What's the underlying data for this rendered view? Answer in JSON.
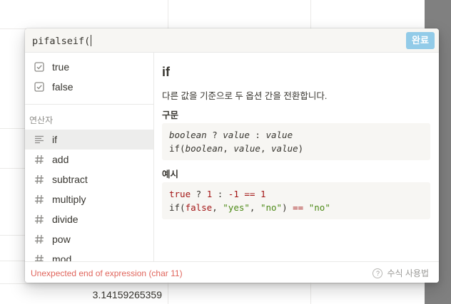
{
  "background": {
    "cell_value": "3.14159265359"
  },
  "formula": {
    "input_value": "pifalseif(",
    "done_label": "완료"
  },
  "sidebar": {
    "top_items": [
      {
        "label": "true",
        "icon": "checkbox-icon"
      },
      {
        "label": "false",
        "icon": "checkbox-icon"
      }
    ],
    "operators_header": "연산자",
    "operators": [
      {
        "label": "if",
        "icon": "lines-icon"
      },
      {
        "label": "add",
        "icon": "hash-icon"
      },
      {
        "label": "subtract",
        "icon": "hash-icon"
      },
      {
        "label": "multiply",
        "icon": "hash-icon"
      },
      {
        "label": "divide",
        "icon": "hash-icon"
      },
      {
        "label": "pow",
        "icon": "hash-icon"
      },
      {
        "label": "mod",
        "icon": "hash-icon"
      }
    ]
  },
  "detail": {
    "title": "if",
    "description": "다른 값을 기준으로 두 옵션 간을 전환합니다.",
    "syntax_heading": "구문",
    "syntax_lines": [
      "boolean ? value : value",
      "if(boolean, value, value)"
    ],
    "example_heading": "예시",
    "example_lines": [
      "true ? 1 : -1 == 1",
      "if(false, \"yes\", \"no\") == \"no\""
    ]
  },
  "footer": {
    "error": "Unexpected end of expression (char 11)",
    "help_label": "수식 사용법"
  },
  "colors": {
    "done_button": "#92cbe8",
    "error": "#e0655c",
    "string": "#4d8a17",
    "keyword": "#a31515"
  }
}
